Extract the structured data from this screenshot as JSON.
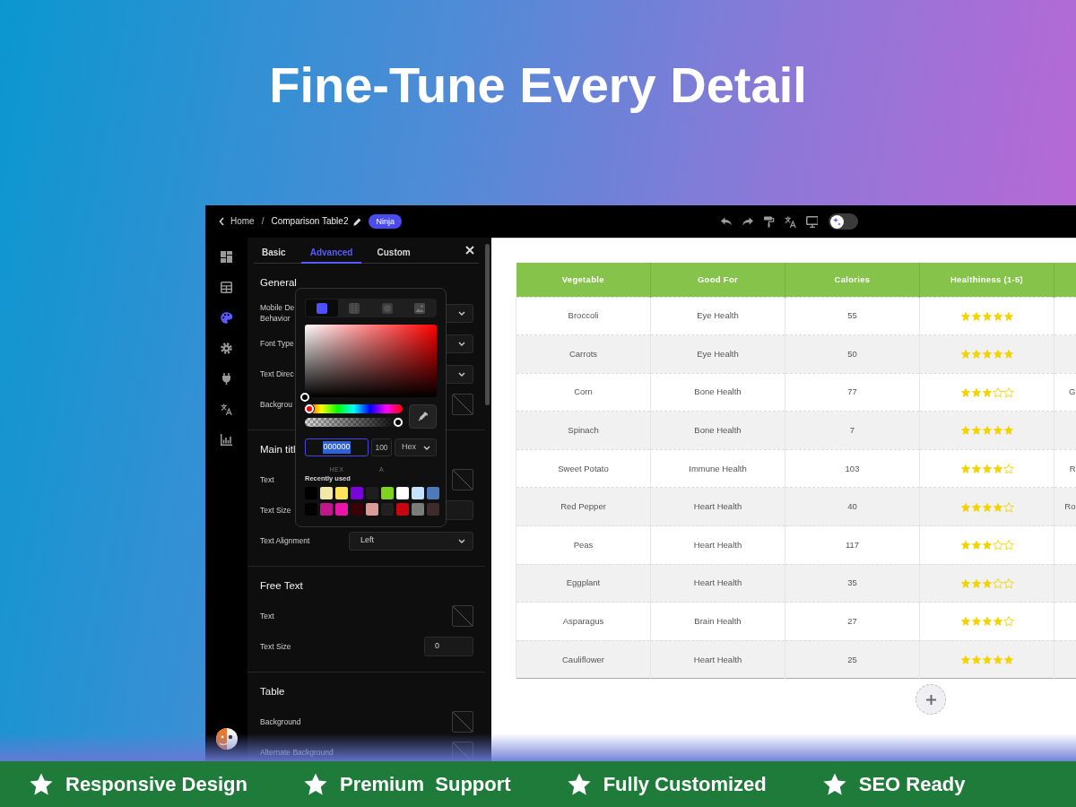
{
  "hero": {
    "title": "Fine-Tune Every Detail"
  },
  "topbar": {
    "back_label": "Home",
    "separator": "/",
    "page_title": "Comparison Table2",
    "badge": "Ninja",
    "tools": [
      {
        "kind": "undo"
      },
      {
        "kind": "redo"
      },
      {
        "kind": "paint"
      },
      {
        "kind": "translate"
      },
      {
        "kind": "monitor"
      }
    ],
    "ai_toggle": {
      "on": false
    }
  },
  "rail": {
    "items": [
      {
        "kind": "dashboard",
        "selected": false
      },
      {
        "kind": "table",
        "selected": false
      },
      {
        "kind": "palette",
        "selected": true
      },
      {
        "kind": "settings",
        "selected": false
      },
      {
        "kind": "plugin",
        "selected": false
      },
      {
        "kind": "translate",
        "selected": false
      },
      {
        "kind": "chart",
        "selected": false
      }
    ]
  },
  "panel": {
    "tabs": [
      {
        "label": "Basic",
        "selected": false
      },
      {
        "label": "Advanced",
        "selected": true
      },
      {
        "label": "Custom",
        "selected": false
      }
    ],
    "sections": [
      {
        "title": "General",
        "rows": [
          {
            "label": "Mobile De\nBehavior",
            "kind": "select"
          },
          {
            "label": "Font Type",
            "kind": "select"
          },
          {
            "label": "Text Direc",
            "kind": "select"
          },
          {
            "label": "Backgrou",
            "kind": "color"
          }
        ]
      },
      {
        "title": "Main titl",
        "rows": [
          {
            "label": "Text",
            "kind": "color"
          },
          {
            "label": "Text Size",
            "kind": "number"
          },
          {
            "label": "Text Alignment",
            "kind": "select",
            "value": "Left"
          }
        ]
      },
      {
        "title": "Free Text",
        "rows": [
          {
            "label": "Text",
            "kind": "color"
          },
          {
            "label": "Text Size",
            "kind": "number",
            "value": "0"
          }
        ]
      },
      {
        "title": "Table",
        "rows": [
          {
            "label": "Background",
            "kind": "color"
          },
          {
            "label": "Alternate Background",
            "kind": "color"
          }
        ]
      }
    ]
  },
  "color_picker": {
    "modes": [
      {
        "kind": "solid",
        "selected": true
      },
      {
        "kind": "linear",
        "selected": false
      },
      {
        "kind": "radial",
        "selected": false
      },
      {
        "kind": "image",
        "selected": false
      }
    ],
    "hue": {
      "level": 0
    },
    "alpha": {
      "level": 1
    },
    "hex_value": "000000",
    "hex_label": "HEX",
    "alpha_value": "100",
    "alpha_label": "A",
    "format": "Hex",
    "recent_label": "Recently used",
    "recent_colors": [
      {
        "color": "#000000"
      },
      {
        "color": "#f3e9a7"
      },
      {
        "color": "#fde35a"
      },
      {
        "color": "#7a04dc"
      },
      {
        "color": "#1e1e1e"
      },
      {
        "color": "#7ed321"
      },
      {
        "color": "#ffffff"
      },
      {
        "color": "#c6e1fb"
      },
      {
        "color": "#4d7ab8"
      },
      {
        "color": "#030303"
      },
      {
        "color": "#c0188b"
      },
      {
        "color": "#ec13a8"
      },
      {
        "color": "#3a0008"
      },
      {
        "color": "#d99a9a"
      },
      {
        "color": "#202020"
      },
      {
        "color": "#c9060f"
      },
      {
        "color": "#7b7d7b"
      },
      {
        "color": "#3e2b2c"
      }
    ]
  },
  "table": {
    "columns": [
      "Vegetable",
      "Good For",
      "Calories",
      "Healthiness (1-5)"
    ],
    "rows": [
      {
        "vegetable": "Broccoli",
        "good_for": "Eye Health",
        "calories": "55",
        "stars": 5
      },
      {
        "vegetable": "Carrots",
        "good_for": "Eye Health",
        "calories": "50",
        "stars": 5
      },
      {
        "vegetable": "Corn",
        "good_for": "Bone Health",
        "calories": "77",
        "stars": 3,
        "column_5": "G"
      },
      {
        "vegetable": "Spinach",
        "good_for": "Bone Health",
        "calories": "7",
        "stars": 5
      },
      {
        "vegetable": "Sweet Potato",
        "good_for": "Immune Health",
        "calories": "103",
        "stars": 4,
        "column_5": "R"
      },
      {
        "vegetable": "Red Pepper",
        "good_for": "Heart Health",
        "calories": "40",
        "stars": 4,
        "column_5": "Ro"
      },
      {
        "vegetable": "Peas",
        "good_for": "Heart Health",
        "calories": "117",
        "stars": 3
      },
      {
        "vegetable": "Eggplant",
        "good_for": "Heart Health",
        "calories": "35",
        "stars": 3
      },
      {
        "vegetable": "Asparagus",
        "good_for": "Brain Health",
        "calories": "27",
        "stars": 4
      },
      {
        "vegetable": "Cauliflower",
        "good_for": "Heart Health",
        "calories": "25",
        "stars": 5
      }
    ]
  },
  "features": [
    "Responsive Design",
    "Premium  Support",
    "Fully Customized",
    "SEO Ready"
  ]
}
